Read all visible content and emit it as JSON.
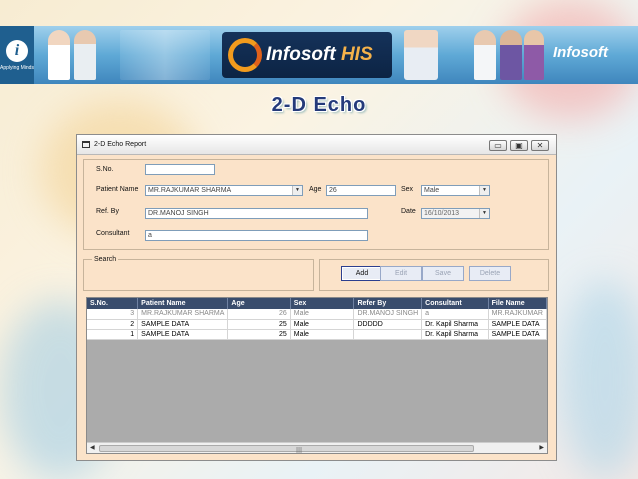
{
  "banner": {
    "logo_letter": "i",
    "logo_tagline": "Applying Minds",
    "brand_main": "Infosoft",
    "brand_suffix": "HIS",
    "brand_right": "Infosoft"
  },
  "slide_title": "2-D Echo",
  "window": {
    "title": "2-D Echo Report",
    "min_glyph": "▭",
    "max_glyph": "▣",
    "close_glyph": "✕"
  },
  "form": {
    "sno_label": "S.No.",
    "sno_value": "",
    "patient_name_label": "Patient Name",
    "patient_name_value": "MR.RAJKUMAR  SHARMA",
    "age_label": "Age",
    "age_value": "26",
    "sex_label": "Sex",
    "sex_value": "Male",
    "ref_by_label": "Ref. By",
    "ref_by_value": "DR.MANOJ SINGH",
    "date_label": "Date",
    "date_value": "16/10/2013",
    "consultant_label": "Consultant",
    "consultant_value": "a"
  },
  "search": {
    "label": "Search"
  },
  "buttons": {
    "add": "Add",
    "edit": "Edit",
    "save": "Save",
    "delete": "Delete"
  },
  "grid": {
    "columns": [
      "S.No.",
      "Patient Name",
      "Age",
      "Sex",
      "Refer By",
      "Consultant",
      "File Name"
    ],
    "rows": [
      [
        "3",
        "MR.RAJKUMAR  SHARMA",
        "26",
        "Male",
        "DR.MANOJ SINGH",
        "a",
        "MR.RAJKUMAR"
      ],
      [
        "2",
        "SAMPLE DATA",
        "25",
        "Male",
        "DDDDD",
        "Dr. Kapil Sharma",
        "SAMPLE DATA"
      ],
      [
        "1",
        "SAMPLE DATA",
        "25",
        "Male",
        "",
        "Dr. Kapil Sharma",
        "SAMPLE DATA"
      ]
    ]
  },
  "scrollbar": {
    "left_arrow": "◀",
    "right_arrow": "▶",
    "grip": "|||"
  },
  "colors": {
    "window_bg": "#fbe3c9",
    "grid_header": "#3a4d6d",
    "title_color": "#243a7a"
  }
}
